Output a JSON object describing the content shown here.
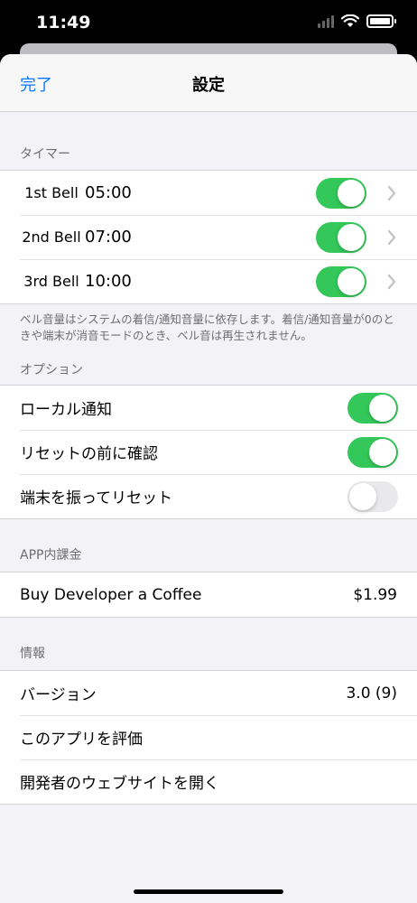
{
  "status_bar": {
    "time": "11:49"
  },
  "nav": {
    "done": "完了",
    "title": "設定"
  },
  "timer": {
    "header": "タイマー",
    "bells": [
      {
        "name": "1st Bell",
        "time": "05:00",
        "enabled": true
      },
      {
        "name": "2nd Bell",
        "time": "07:00",
        "enabled": true
      },
      {
        "name": "3rd Bell",
        "time": "10:00",
        "enabled": true
      }
    ],
    "footnote": "ベル音量はシステムの着信/通知音量に依存します。着信/通知音量が0のときや端末が消音モードのとき、ベル音は再生されません。"
  },
  "options": {
    "header": "オプション",
    "items": [
      {
        "label": "ローカル通知",
        "enabled": true
      },
      {
        "label": "リセットの前に確認",
        "enabled": true
      },
      {
        "label": "端末を振ってリセット",
        "enabled": false
      }
    ]
  },
  "iap": {
    "header": "APP内課金",
    "item": {
      "label": "Buy Developer a Coffee",
      "price": "$1.99"
    }
  },
  "info": {
    "header": "情報",
    "version_label": "バージョン",
    "version_value": "3.0 (9)",
    "rate_label": "このアプリを評価",
    "website_label": "開発者のウェブサイトを開く"
  },
  "colors": {
    "accent": "#0a7aff",
    "toggle_on": "#34c759",
    "toggle_off": "#e9e9eb",
    "background": "#f2f2f7"
  }
}
